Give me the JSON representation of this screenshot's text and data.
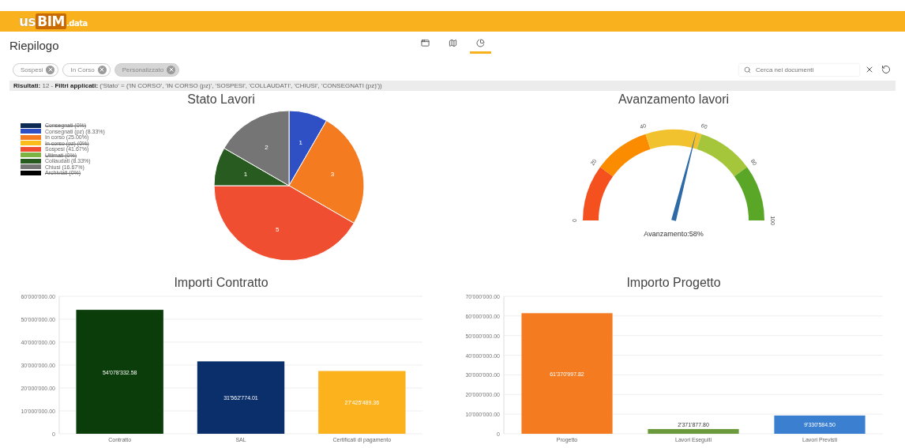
{
  "header": {
    "logo": [
      "us",
      "BIM",
      ".data"
    ]
  },
  "page_title": "Riepilogo",
  "views": [
    {
      "kind": "table",
      "selected": false
    },
    {
      "kind": "map",
      "selected": false
    },
    {
      "kind": "chart",
      "selected": true
    }
  ],
  "filter_chips": [
    {
      "label": "Sospesi",
      "selected": false
    },
    {
      "label": "In Corso",
      "selected": false
    },
    {
      "label": "Personalizzato",
      "selected": true
    }
  ],
  "search": {
    "placeholder": "Cerca nei documenti"
  },
  "results": "**Risultati:** 12 - **Filtri applicati:** ('Stato' = ('IN CORSO', 'IN CORSO (pz)', 'SOSPESI', 'COLLAUDATI', 'CHIUSI', 'CONSEGNATI (pz)'))",
  "stato_lavori": {
    "title": "Stato Lavori",
    "legend": [
      {
        "color": "#0d2b52",
        "hidden": true
      },
      {
        "color": "#2f4fc4",
        "hidden": false
      },
      {
        "color": "#f47b20",
        "hidden": false
      },
      {
        "color": "#fbbd1c",
        "hidden": true
      },
      {
        "color": "#f04e30",
        "hidden": false
      },
      {
        "color": "#7cb342",
        "hidden": true
      },
      {
        "color": "#285b1f",
        "hidden": false
      },
      {
        "color": "#757575",
        "hidden": false
      },
      {
        "color": "#000000",
        "hidden": true
      }
    ],
    "chart_data": {
      "type": "pie",
      "categories": [
        "Consegnati (0%)",
        "Consegnati (pz) (8.33%)",
        "In corso (25.00%)",
        "In corso (pz) (0%)",
        "Sospesi (41.67%)",
        "Ultimati (0%)",
        "Collaudati (8.33%)",
        "Chiusi (16.67%)",
        "Archiviati (0%)"
      ],
      "values": [
        0,
        1,
        3,
        0,
        5,
        0,
        1,
        2,
        0
      ],
      "data_labels": true
    }
  },
  "avanzamento": {
    "title": "Avanzamento lavori",
    "ticks": [
      "0",
      "20",
      "40",
      "60",
      "80",
      "100"
    ],
    "label": "Avanzamento:58%"
  },
  "importi_contratto": {
    "title": "Importi Contratto",
    "chart_data": {
      "type": "bar",
      "series": [
        {
          "name": "Contratto",
          "color": "#0b3d0b",
          "values": [
            54100000,
            null,
            null
          ]
        },
        {
          "name": "SAL",
          "color": "#0b2f6b",
          "values": [
            null,
            31600000,
            null
          ]
        },
        {
          "name": "Certificati di pagamento",
          "color": "#fbb21d",
          "values": [
            null,
            null,
            27400000
          ]
        }
      ],
      "grid": true,
      "value_labels": [
        "54'078'332.58",
        "31'562'774.01",
        "27'425'489.36"
      ],
      "ylim": [
        0,
        60000000
      ],
      "yticks": [
        {
          "value": 0,
          "label": "0"
        },
        {
          "value": 10000000,
          "label": "10'000'000.00"
        },
        {
          "value": 20000000,
          "label": "20'000'000.00"
        },
        {
          "value": 30000000,
          "label": "30'000'000.00"
        },
        {
          "value": 40000000,
          "label": "40'000'000.00"
        },
        {
          "value": 50000000,
          "label": "50'000'000.00"
        },
        {
          "value": 60000000,
          "label": "60'000'000.00"
        }
      ]
    }
  },
  "importo_progetto": {
    "title": "Importo Progetto",
    "chart_data": {
      "type": "bar",
      "series": [
        {
          "name": "Progetto",
          "color": "#f47b20",
          "values": [
            61400000,
            null,
            null
          ]
        },
        {
          "name": "Lavori Eseguiti",
          "color": "#6a9a3c",
          "values": [
            null,
            2400000,
            null
          ]
        },
        {
          "name": "Lavori Previsti",
          "color": "#3a7fd0",
          "values": [
            null,
            null,
            9300000
          ]
        }
      ],
      "grid": true,
      "value_labels": [
        "61'370'997.82",
        "2'371'877.80",
        "9'330'584.50"
      ],
      "ylim": [
        0,
        70000000
      ],
      "yticks": [
        {
          "value": 0,
          "label": "0"
        },
        {
          "value": 10000000,
          "label": "10'000'000.00"
        },
        {
          "value": 20000000,
          "label": "20'000'000.00"
        },
        {
          "value": 30000000,
          "label": "30'000'000.00"
        },
        {
          "value": 40000000,
          "label": "40'000'000.00"
        },
        {
          "value": 50000000,
          "label": "50'000'000.00"
        },
        {
          "value": 60000000,
          "label": "60'000'000.00"
        },
        {
          "value": 70000000,
          "label": "70'000'000.00"
        }
      ]
    }
  }
}
